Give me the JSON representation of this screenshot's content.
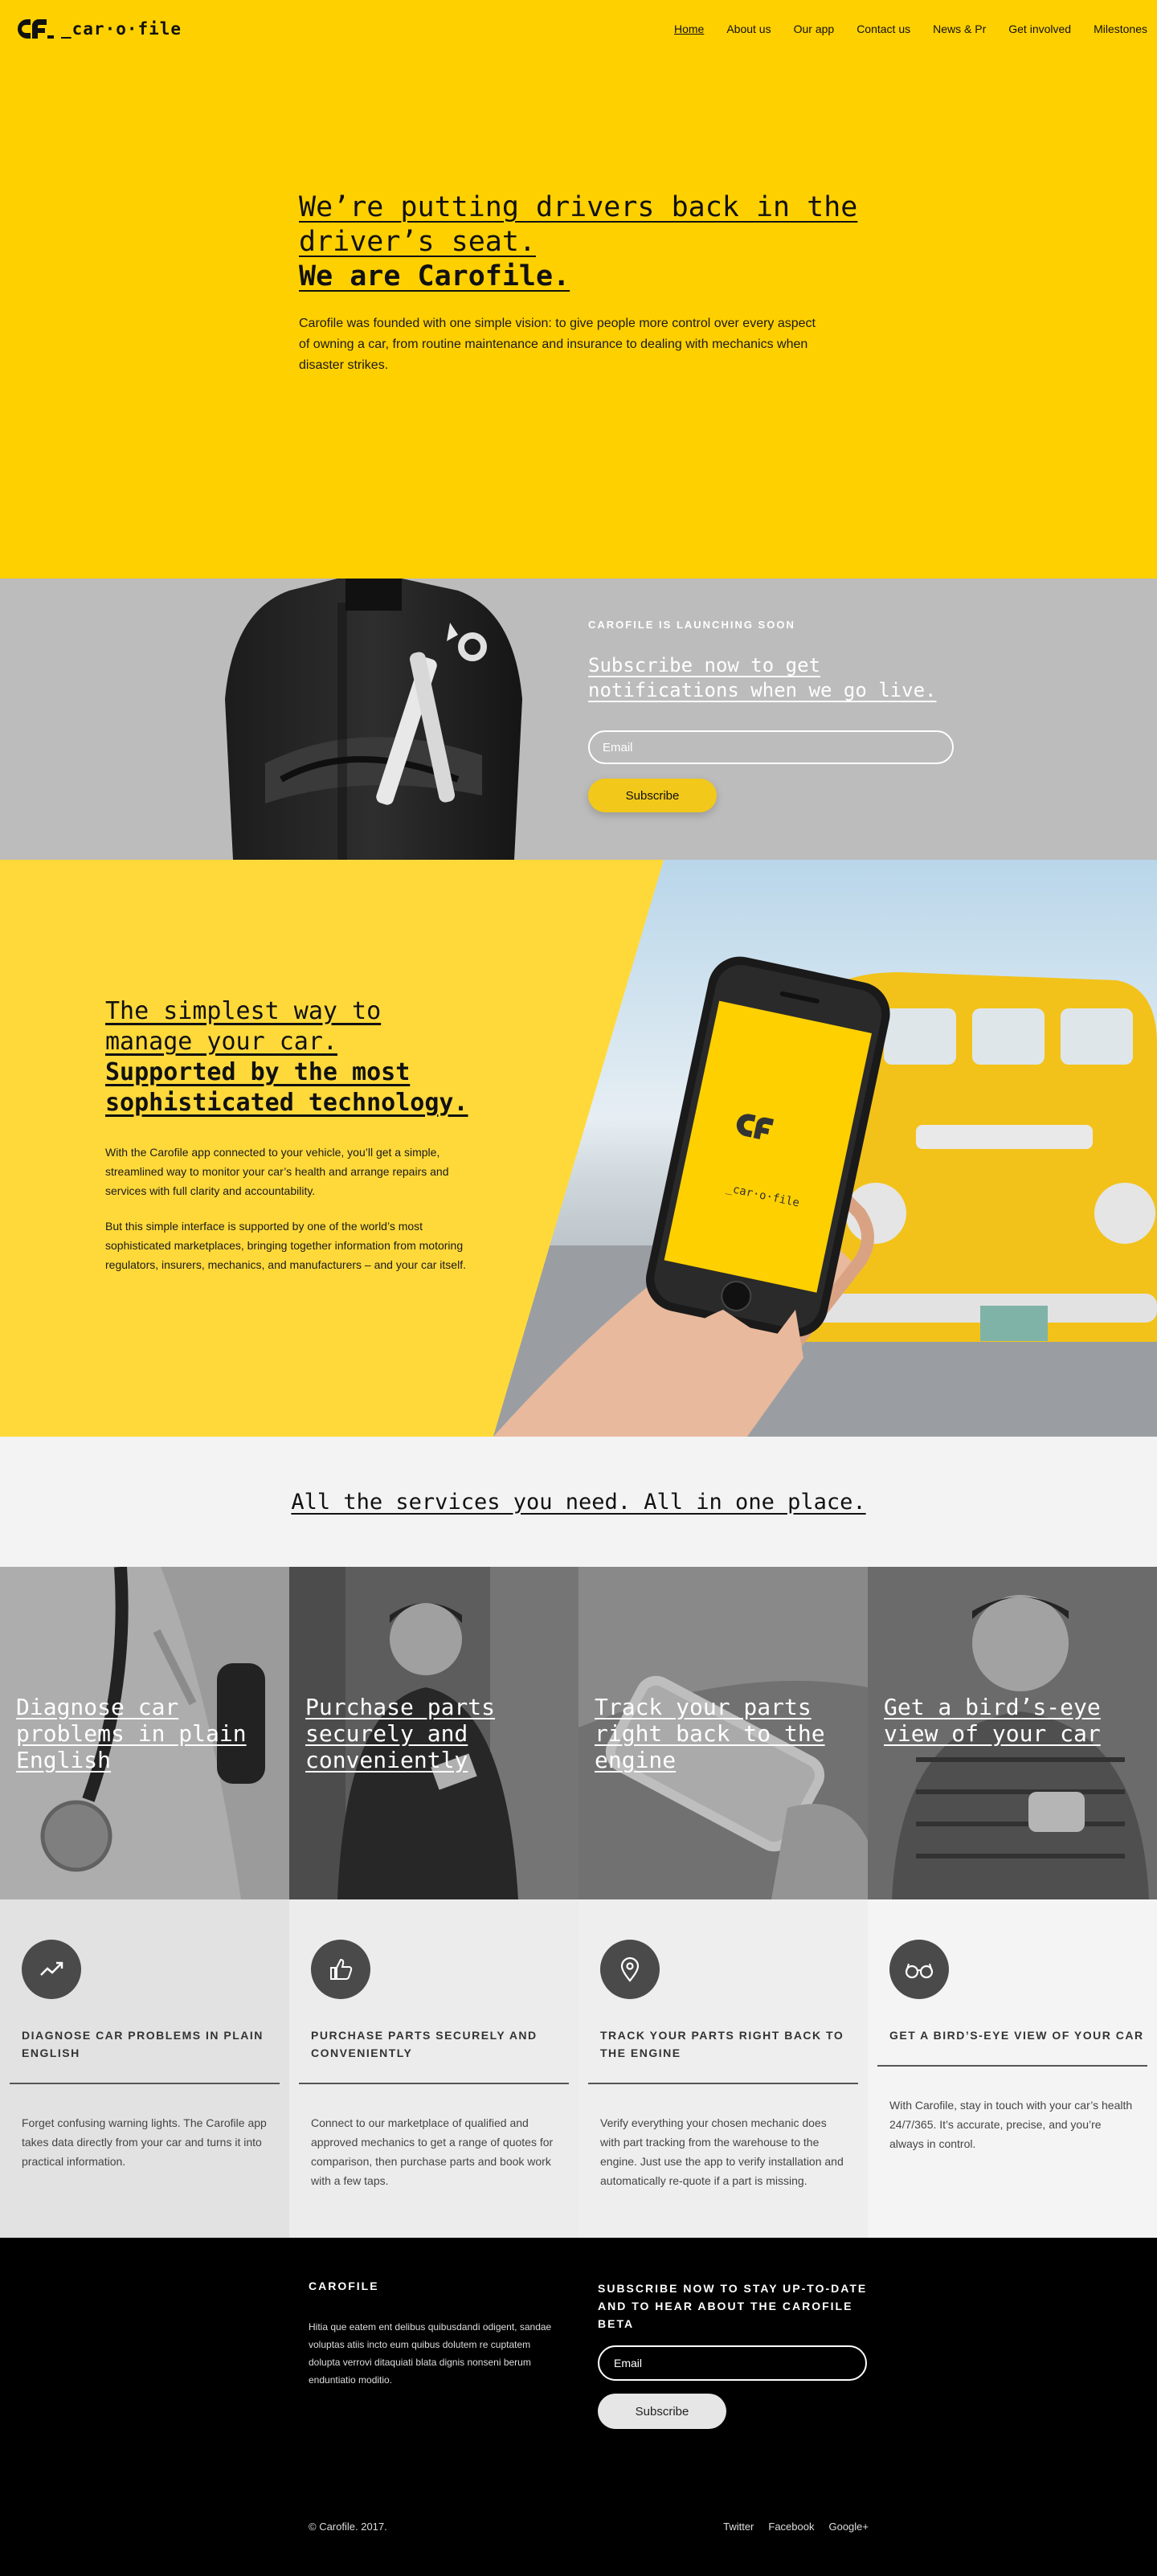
{
  "header": {
    "logo_text": "_car·o·file",
    "nav": [
      "Home",
      "About us",
      "Our app",
      "Contact us",
      "News & Pr",
      "Get involved",
      "Milestones"
    ]
  },
  "hero": {
    "line1": "We’re putting drivers back in the",
    "line2": "driver’s seat.",
    "line3": "We are Carofile.",
    "body": "Carofile was founded with one simple vision: to give people more control over every aspect of owning a car, from routine maintenance and insurance to dealing with mechanics when disaster strikes."
  },
  "launch": {
    "kicker": "CAROFILE IS LAUNCHING SOON",
    "title": "Subscribe now to get notifications when we go live.",
    "email_placeholder": "Email",
    "button": "Subscribe"
  },
  "app": {
    "line1": "The simplest way to",
    "line2": "manage your car.",
    "line3": "Supported by the most",
    "line4": "sophisticated technology.",
    "para1": "With the Carofile app connected to your vehicle, you’ll get a simple, streamlined way to monitor your car’s health and arrange repairs and services with full clarity and accountability.",
    "para2": "But this simple interface is supported by one of the world’s most sophisticated marketplaces, bringing together information from motoring regulators, insurers, mechanics, and manufacturers – and your car itself.",
    "phone_logo": "_car·o·file"
  },
  "services": {
    "title": "All the services you need. All in one place.",
    "tiles": [
      "Diagnose car problems in plain English",
      "Purchase parts securely and conveniently",
      "Track your parts right back to the engine",
      "Get a bird’s-eye view of your car"
    ],
    "features": [
      {
        "icon": "trend-line-icon",
        "title": "DIAGNOSE CAR PROBLEMS IN PLAIN ENGLISH",
        "body": "Forget confusing warning lights. The Carofile app takes data directly from your car and turns it into practical information.",
        "bg": "#e2e2e2"
      },
      {
        "icon": "thumbs-up-icon",
        "title": "PURCHASE PARTS SECURELY AND CONVENIENTLY",
        "body": "Connect to our marketplace of qualified and approved mechanics to get a range of quotes for comparison, then purchase parts and book work with a few taps.",
        "bg": "#ececec"
      },
      {
        "icon": "map-pin-icon",
        "title": "TRACK YOUR PARTS RIGHT BACK TO THE ENGINE",
        "body": "Verify everything your chosen mechanic does with part tracking from the warehouse to the engine. Just use the app to verify installation and automatically re-quote if a part is missing.",
        "bg": "#eeeeee"
      },
      {
        "icon": "glasses-icon",
        "title": "GET A BIRD’S-EYE VIEW OF YOUR CAR",
        "body": "With Carofile, stay in touch with your car’s health 24/7/365. It’s accurate, precise, and you’re always in control.",
        "bg": "#f4f4f4"
      }
    ]
  },
  "footer": {
    "brand": "CAROFILE",
    "about": "Hitia que eatem ent delibus quibusdandi odigent, sandae voluptas atiis incto eum quibus dolutem re cuptatem dolupta verrovi ditaquiati blata dignis nonseni berum enduntiatio moditio.",
    "subscribe_title": "SUBSCRIBE NOW TO STAY UP-TO-DATE AND TO HEAR ABOUT THE CAROFILE BETA",
    "email_placeholder": "Email",
    "button": "Subscribe",
    "copyright": "© Carofile. 2017.",
    "social": [
      "Twitter",
      "Facebook",
      "Google+"
    ]
  },
  "colors": {
    "brand_yellow": "#ffd000",
    "dark": "#111111"
  }
}
